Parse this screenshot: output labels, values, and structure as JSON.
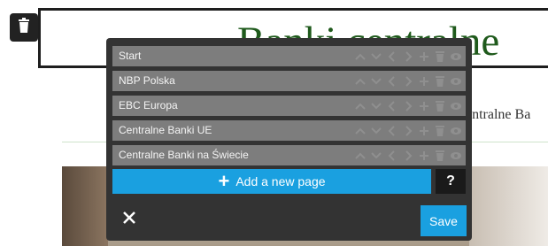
{
  "page": {
    "title": "Banki centralne",
    "subtitle": "entralne Ba"
  },
  "panel": {
    "pages": [
      {
        "label": "Start"
      },
      {
        "label": "NBP Polska"
      },
      {
        "label": "EBC Europa"
      },
      {
        "label": "Centralne Banki UE"
      },
      {
        "label": "Centralne Banki na Świecie"
      }
    ],
    "row_icons": [
      "chevron-up-icon",
      "chevron-down-icon",
      "chevron-left-icon",
      "chevron-right-icon",
      "plus-icon",
      "trash-icon",
      "eye-icon"
    ],
    "add_page_label": "Add a new page",
    "help_label": "?",
    "save_label": "Save"
  },
  "colors": {
    "panel_bg": "#333333",
    "row_bg": "#7d7d7d",
    "accent": "#1aa0e0",
    "title_green": "#1f5a1c"
  }
}
